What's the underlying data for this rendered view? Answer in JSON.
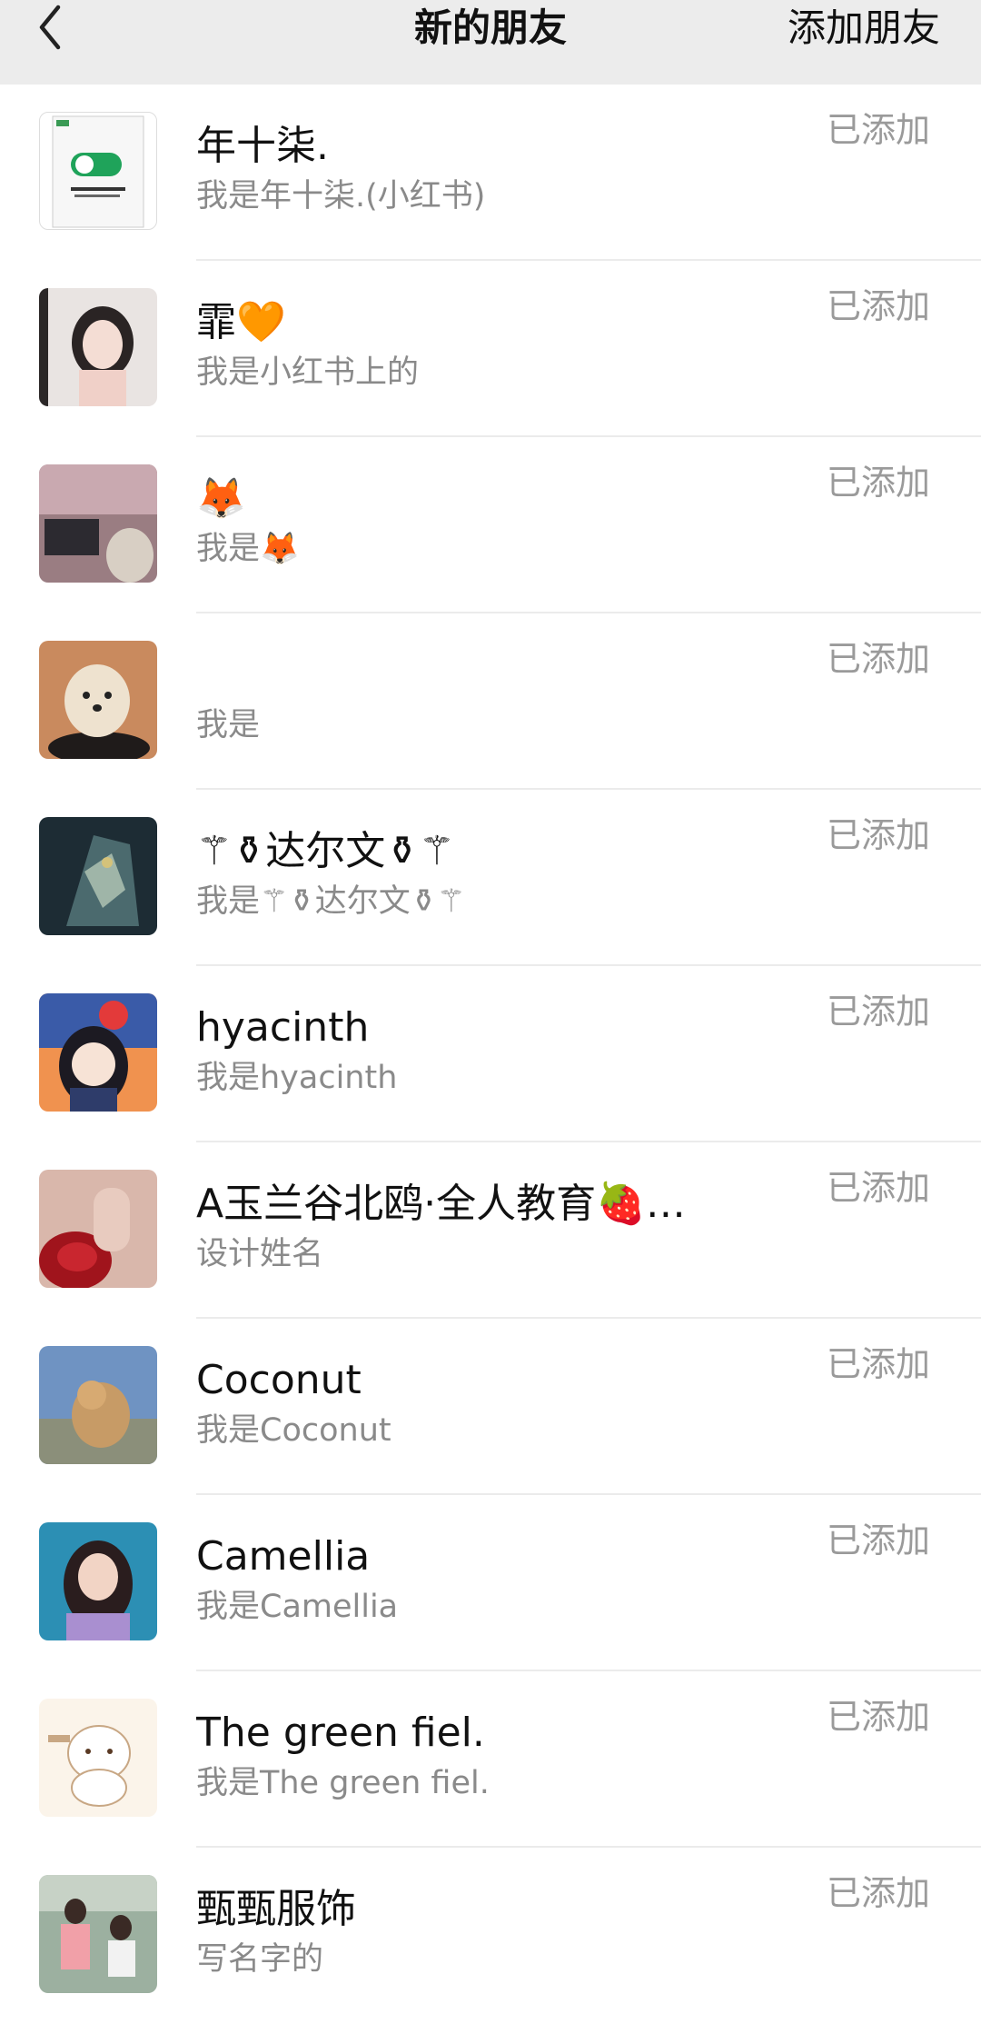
{
  "header": {
    "back_icon": "chevron-left-icon",
    "title": "新的朋友",
    "action_label": "添加朋友"
  },
  "friends": [
    {
      "name": "年十柒.",
      "message": "我是年十柒.(小红书)",
      "status": "已添加"
    },
    {
      "name": "霏🧡",
      "message": "我是小红书上的",
      "status": "已添加"
    },
    {
      "name": "🦊",
      "message": "我是🦊",
      "status": "已添加"
    },
    {
      "name": "",
      "message": "我是",
      "status": "已添加"
    },
    {
      "name": "⚚⚱达尔文⚱⚚",
      "message": "我是⚚⚱达尔文⚱⚚",
      "status": "已添加"
    },
    {
      "name": "hyacinth",
      "message": "我是hyacinth",
      "status": "已添加"
    },
    {
      "name": "A玉兰谷北鸥·全人教育🍓…",
      "message": "设计姓名",
      "status": "已添加"
    },
    {
      "name": "Coconut",
      "message": "我是Coconut",
      "status": "已添加"
    },
    {
      "name": "Camellia",
      "message": "我是Camellia",
      "status": "已添加"
    },
    {
      "name": "The green fiel.",
      "message": "我是The green fiel.",
      "status": "已添加"
    },
    {
      "name": "甄甄服饰",
      "message": "写名字的",
      "status": "已添加"
    }
  ]
}
